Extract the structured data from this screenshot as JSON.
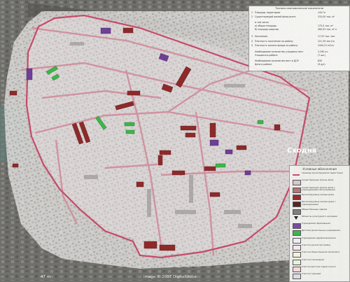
{
  "econ_panel": {
    "title": "Технико-экономические показатели",
    "rows": [
      {
        "n": "1",
        "label": "Площадь территории",
        "value": "144 Га"
      },
      {
        "n": "2",
        "label": "Существующий жилой фонд всего",
        "value": "315,00 тыс. м²"
      },
      {
        "n": "",
        "label": "в том числе",
        "value": ""
      },
      {
        "n": "",
        "label": "а) общая площадь",
        "value": "173,0 тыс. м²"
      },
      {
        "n": "",
        "label": "б) площадь квартир",
        "value": "280,03 тыс. м² п"
      },
      {
        "n": "3",
        "label": "Население",
        "value": "17,03 тыс. чел."
      },
      {
        "n": "4",
        "label": "Плотность населения по району",
        "value": "121,39 чел./га"
      },
      {
        "n": "5",
        "label": "Плотность жилого фонда по району",
        "value": "2440,21 м²/га"
      },
      {
        "n": "",
        "label": "Необходимое количество учащихся мест",
        "value": "2.290 уч."
      },
      {
        "n": "",
        "label": "Учащиеся в районе",
        "value": "(7 шк.)"
      },
      {
        "n": "",
        "label": "Необходимое количество мест в ДОУ",
        "value": "830"
      },
      {
        "n": "",
        "label": "Дети в районе",
        "value": "(9 д/с)"
      }
    ]
  },
  "legend": {
    "title": "Условные обозначения",
    "items": [
      {
        "label": "Граница проектируемой территории",
        "color": "#c0506c",
        "kind": "line"
      },
      {
        "label": "Существующие жилые дома",
        "color": "#d9c8c8",
        "kind": "box"
      },
      {
        "label": "Существующие жилые дома с учреждениями обслуживания",
        "color": "#b07878",
        "kind": "box"
      },
      {
        "label": "Проектируемые жилые дома",
        "color": "#9a2a2a",
        "kind": "box"
      },
      {
        "label": "Проектируемые жилые дома с учреждениями",
        "color": "#5a2424",
        "kind": "box"
      },
      {
        "label": "Общественные здания",
        "color": "#7f7f7f",
        "kind": "box"
      },
      {
        "label": "Объекты культурного наследия",
        "color": "#222222",
        "kind": "triangle"
      },
      {
        "label": "Учреждения образования",
        "color": "#7a4da0",
        "kind": "box"
      },
      {
        "label": "Детские дошкольные учреждения",
        "color": "#3db64a",
        "kind": "box"
      },
      {
        "label": "Учреждения здравоохранения",
        "color": "#f0eef2",
        "kind": "box"
      },
      {
        "label": "Участки жилой застройки",
        "color": "#f6e6ee",
        "kind": "box"
      },
      {
        "label": "Участки общественной застройки",
        "color": "#f6f0d8",
        "kind": "box"
      },
      {
        "label": "Участки озеленения",
        "color": "#e8f0d8",
        "kind": "box"
      },
      {
        "label": "Участки детских садов и школ",
        "color": "#f6d8d8",
        "kind": "box"
      },
      {
        "label": "Участки гаражей",
        "color": "#dcdce8",
        "kind": "box"
      }
    ]
  },
  "map": {
    "area_label": "Сходня",
    "scale_label": "47 m"
  },
  "footer": {
    "copyright": "Image © 2007 DigitalGlobe"
  },
  "colors": {
    "boundary": "#c64a6a",
    "roads": "#d08c9c",
    "new_housing": "#8e2a2a",
    "schools": "#6f3f96",
    "kindergartens": "#3db64a",
    "overlay": "#ececec",
    "satellite": "#6f6f6b"
  }
}
